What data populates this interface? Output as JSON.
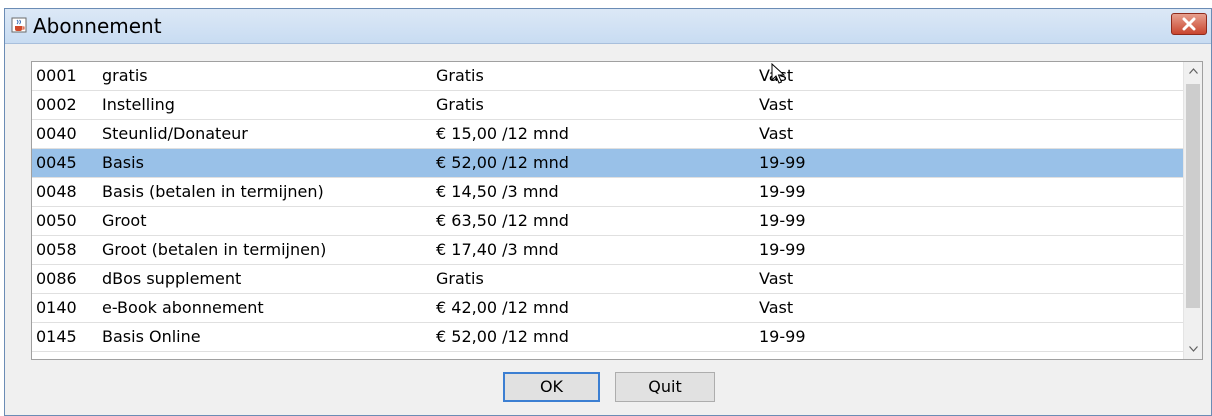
{
  "window": {
    "title": "Abonnement",
    "title_icon": "java-cup-icon",
    "close_icon": "close-icon"
  },
  "colors": {
    "titlebar": "#c8dcf2",
    "selected_row": "#99c1e8",
    "close_button": "#c9462f",
    "default_button_border": "#3c7fd2"
  },
  "table": {
    "rows": [
      {
        "code": "0001",
        "name": "gratis",
        "price": "Gratis",
        "period": "Vast",
        "selected": false
      },
      {
        "code": "0002",
        "name": "Instelling",
        "price": "Gratis",
        "period": "Vast",
        "selected": false
      },
      {
        "code": "0040",
        "name": "Steunlid/Donateur",
        "price": "€ 15,00 /12 mnd",
        "period": "Vast",
        "selected": false
      },
      {
        "code": "0045",
        "name": "Basis",
        "price": "€ 52,00 /12 mnd",
        "period": "19-99",
        "selected": true
      },
      {
        "code": "0048",
        "name": "Basis (betalen in termijnen)",
        "price": "€ 14,50 /3 mnd",
        "period": "19-99",
        "selected": false
      },
      {
        "code": "0050",
        "name": "Groot",
        "price": "€ 63,50 /12 mnd",
        "period": "19-99",
        "selected": false
      },
      {
        "code": "0058",
        "name": "Groot (betalen in termijnen)",
        "price": "€ 17,40 /3 mnd",
        "period": "19-99",
        "selected": false
      },
      {
        "code": "0086",
        "name": "dBos supplement",
        "price": "Gratis",
        "period": "Vast",
        "selected": false
      },
      {
        "code": "0140",
        "name": "e-Book abonnement",
        "price": "€ 42,00 /12 mnd",
        "period": "Vast",
        "selected": false
      },
      {
        "code": "0145",
        "name": "Basis Online",
        "price": "€ 52,00 /12 mnd",
        "period": "19-99",
        "selected": false
      }
    ]
  },
  "buttons": {
    "ok": "OK",
    "quit": "Quit"
  }
}
